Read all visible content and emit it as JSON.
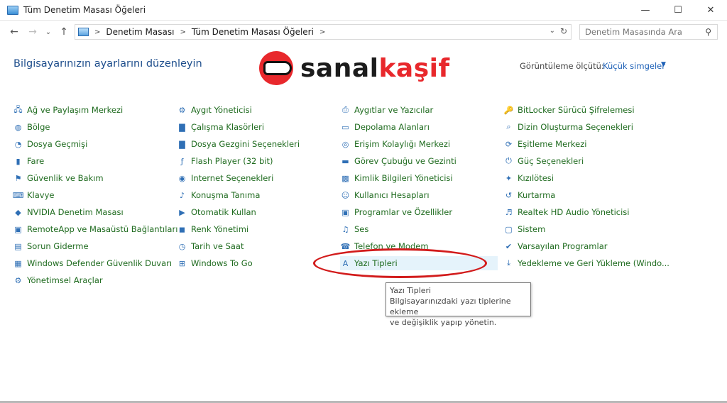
{
  "window": {
    "title": "Tüm Denetim Masası Öğeleri",
    "minimize": "—",
    "maximize": "☐",
    "close": "✕"
  },
  "nav": {
    "back": "←",
    "forward": "→",
    "recent": "⌄",
    "up": "↑",
    "breadcrumbs": [
      "Denetim Masası",
      "Tüm Denetim Masası Öğeleri"
    ],
    "dropdown": "⌄",
    "refresh": "↻",
    "search_placeholder": "Denetim Masasında Ara"
  },
  "header": {
    "title": "Bilgisayarınızın ayarlarını düzenleyin",
    "view_label": "Görüntüleme ölçütü:",
    "view_value": "Küçük simgeler",
    "caret": "▼"
  },
  "watermark": {
    "part1": "sanal",
    "part2": "kaşif"
  },
  "columns": [
    [
      {
        "label": "Ağ ve Paylaşım Merkezi",
        "icon": "network-icon",
        "glyph": "🖧"
      },
      {
        "label": "Bölge",
        "icon": "globe-icon",
        "glyph": "◍"
      },
      {
        "label": "Dosya Geçmişi",
        "icon": "history-icon",
        "glyph": "◔"
      },
      {
        "label": "Fare",
        "icon": "mouse-icon",
        "glyph": "▮"
      },
      {
        "label": "Güvenlik ve Bakım",
        "icon": "flag-icon",
        "glyph": "⚑"
      },
      {
        "label": "Klavye",
        "icon": "keyboard-icon",
        "glyph": "⌨"
      },
      {
        "label": "NVIDIA Denetim Masası",
        "icon": "nvidia-icon",
        "glyph": "◆"
      },
      {
        "label": "RemoteApp ve Masaüstü Bağlantıları",
        "icon": "remote-icon",
        "glyph": "▣"
      },
      {
        "label": "Sorun Giderme",
        "icon": "troubleshoot-icon",
        "glyph": "▤"
      },
      {
        "label": "Windows Defender Güvenlik Duvarı",
        "icon": "firewall-icon",
        "glyph": "▦"
      },
      {
        "label": "Yönetimsel Araçlar",
        "icon": "admin-tools-icon",
        "glyph": "⚙"
      }
    ],
    [
      {
        "label": "Aygıt Yöneticisi",
        "icon": "device-manager-icon",
        "glyph": "⚙"
      },
      {
        "label": "Çalışma Klasörleri",
        "icon": "folder-icon",
        "glyph": "▇"
      },
      {
        "label": "Dosya Gezgini Seçenekleri",
        "icon": "folder-options-icon",
        "glyph": "▇"
      },
      {
        "label": "Flash Player (32 bit)",
        "icon": "flash-icon",
        "glyph": "ƒ"
      },
      {
        "label": "Internet Seçenekleri",
        "icon": "internet-icon",
        "glyph": "◉"
      },
      {
        "label": "Konuşma Tanıma",
        "icon": "microphone-icon",
        "glyph": "♪"
      },
      {
        "label": "Otomatik Kullan",
        "icon": "autoplay-icon",
        "glyph": "▶"
      },
      {
        "label": "Renk Yönetimi",
        "icon": "color-icon",
        "glyph": "◼"
      },
      {
        "label": "Tarih ve Saat",
        "icon": "clock-icon",
        "glyph": "◷"
      },
      {
        "label": "Windows To Go",
        "icon": "windows-to-go-icon",
        "glyph": "⊞"
      }
    ],
    [
      {
        "label": "Aygıtlar ve Yazıcılar",
        "icon": "printer-icon",
        "glyph": "⎙"
      },
      {
        "label": "Depolama Alanları",
        "icon": "storage-icon",
        "glyph": "▭"
      },
      {
        "label": "Erişim Kolaylığı Merkezi",
        "icon": "accessibility-icon",
        "glyph": "◎"
      },
      {
        "label": "Görev Çubuğu ve Gezinti",
        "icon": "taskbar-icon",
        "glyph": "▬"
      },
      {
        "label": "Kimlik Bilgileri Yöneticisi",
        "icon": "credentials-icon",
        "glyph": "▩"
      },
      {
        "label": "Kullanıcı Hesapları",
        "icon": "users-icon",
        "glyph": "☺"
      },
      {
        "label": "Programlar ve Özellikler",
        "icon": "programs-icon",
        "glyph": "▣"
      },
      {
        "label": "Ses",
        "icon": "speaker-icon",
        "glyph": "♫"
      },
      {
        "label": "Telefon ve Modem",
        "icon": "phone-icon",
        "glyph": "☎"
      },
      {
        "label": "Yazı Tipleri",
        "icon": "fonts-icon",
        "glyph": "A"
      }
    ],
    [
      {
        "label": "BitLocker Sürücü Şifrelemesi",
        "icon": "bitlocker-icon",
        "glyph": "🔑"
      },
      {
        "label": "Dizin Oluşturma Seçenekleri",
        "icon": "indexing-icon",
        "glyph": "⌕"
      },
      {
        "label": "Eşitleme Merkezi",
        "icon": "sync-icon",
        "glyph": "⟳"
      },
      {
        "label": "Güç Seçenekleri",
        "icon": "power-icon",
        "glyph": "⏻"
      },
      {
        "label": "Kızılötesi",
        "icon": "infrared-icon",
        "glyph": "✦"
      },
      {
        "label": "Kurtarma",
        "icon": "recovery-icon",
        "glyph": "↺"
      },
      {
        "label": "Realtek HD Audio Yöneticisi",
        "icon": "audio-icon",
        "glyph": "♬"
      },
      {
        "label": "Sistem",
        "icon": "system-icon",
        "glyph": "▢"
      },
      {
        "label": "Varsayılan Programlar",
        "icon": "default-programs-icon",
        "glyph": "✔"
      },
      {
        "label": "Yedekleme ve Geri Yükleme (Windo...",
        "icon": "backup-icon",
        "glyph": "⤓"
      }
    ]
  ],
  "tooltip": {
    "title": "Yazı Tipleri",
    "line1": "Bilgisayarınızdaki yazı tiplerine ekleme",
    "line2": "ve değişiklik yapıp yönetin."
  }
}
